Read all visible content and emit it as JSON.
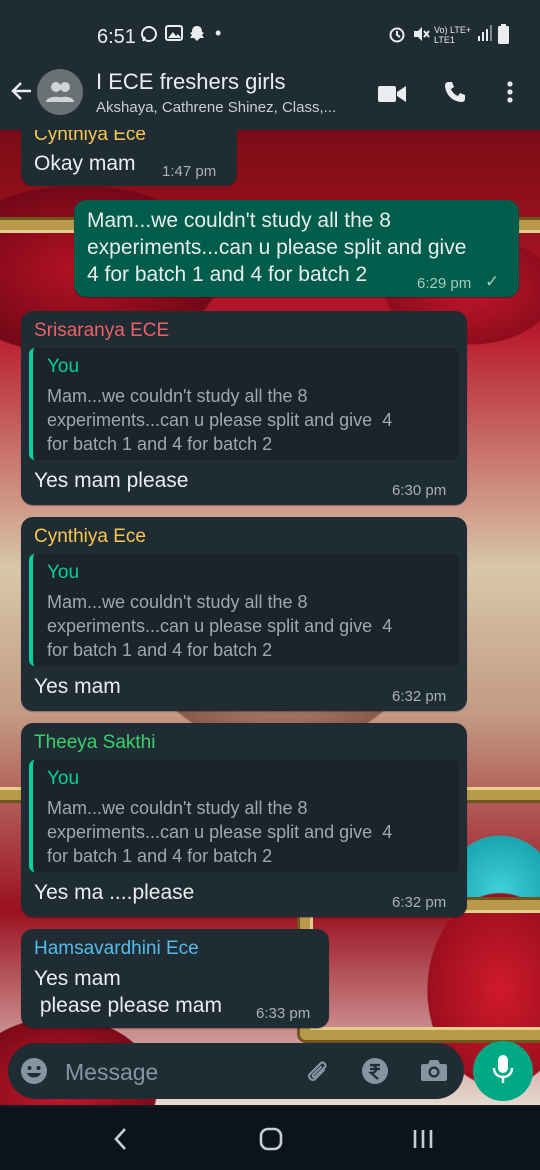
{
  "status_bar": {
    "time": "6:51",
    "icons": [
      "whatsapp-icon",
      "image-icon",
      "snapchat-icon",
      "dot-icon",
      "alarm-icon",
      "mute-icon",
      "volte-icon",
      "signal-icon",
      "battery-icon"
    ],
    "volte_top": "Vo) LTE+",
    "volte_bottom": "LTE1"
  },
  "header": {
    "title": "I ECE freshers girls",
    "subtitle": "Akshaya, Cathrene Shinez, Class,...",
    "icons": [
      "back-arrow-icon",
      "group-avatar-icon",
      "video-call-icon",
      "voice-call-icon",
      "more-options-icon"
    ]
  },
  "messages": [
    {
      "sender": "Cynthiya Ece",
      "text": "Okay mam",
      "time": "1:47 pm",
      "color": "#f9c74f"
    },
    {
      "sender": "",
      "text": "Mam...we couldn't study all the 8\nexperiments...can u please split and give\n4 for batch 1 and 4 for batch 2",
      "time": "6:29 pm",
      "status": "✓",
      "outgoing": true
    },
    {
      "sender": "Srisaranya ECE",
      "text": "Yes mam please",
      "time": "6:30 pm",
      "color": "#ef5f68",
      "quote_author": "You",
      "quote_text": "Mam...we couldn't study all the 8\nexperiments...can u please split and give  4\nfor batch 1 and 4 for batch 2"
    },
    {
      "sender": "Cynthiya Ece",
      "text": "Yes mam",
      "time": "6:32 pm",
      "color": "#f9c74f",
      "quote_author": "You",
      "quote_text": "Mam...we couldn't study all the 8\nexperiments...can u please split and give  4\nfor batch 1 and 4 for batch 2"
    },
    {
      "sender": "Theeya Sakthi",
      "text": "Yes ma ....please",
      "time": "6:32 pm",
      "color": "#36d26b",
      "quote_author": "You",
      "quote_text": "Mam...we couldn't study all the 8\nexperiments...can u please split and give  4\nfor batch 1 and 4 for batch 2"
    },
    {
      "sender": "Hamsavardhini Ece",
      "text": "Yes mam\n please please mam",
      "time": "6:33 pm",
      "color": "#53bdeb"
    }
  ],
  "input": {
    "placeholder": "Message",
    "icons": [
      "emoji-icon",
      "attach-icon",
      "rupee-payment-icon",
      "camera-icon",
      "mic-icon"
    ]
  },
  "nav": {
    "icons": [
      "nav-back-icon",
      "nav-home-icon",
      "nav-recents-icon"
    ]
  },
  "colors": {
    "header_bg": "#1f2c34",
    "incoming_bubble": "#202c33",
    "outgoing_bubble": "#005c4b",
    "accent": "#00a884"
  }
}
